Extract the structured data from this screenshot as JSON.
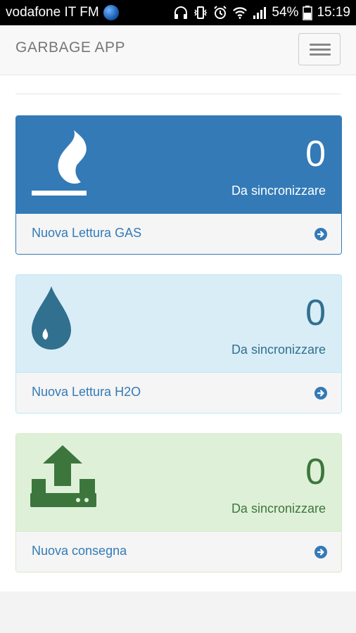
{
  "status_bar": {
    "carrier": "vodafone IT FM",
    "battery": "54%",
    "time": "15:19"
  },
  "navbar": {
    "brand": "GARBAGE APP"
  },
  "panels": [
    {
      "count": "0",
      "label": "Da sincronizzare",
      "footer": "Nuova Lettura GAS",
      "icon": "flame-icon",
      "colors": {
        "heading_bg": "#337ab7",
        "text": "#ffffff",
        "border": "#337ab7"
      }
    },
    {
      "count": "0",
      "label": "Da sincronizzare",
      "footer": "Nuova Lettura H2O",
      "icon": "water-drop-icon",
      "colors": {
        "heading_bg": "#d9edf7",
        "text": "#31708f",
        "border": "#bce8f1"
      }
    },
    {
      "count": "0",
      "label": "Da sincronizzare",
      "footer": "Nuova consegna",
      "icon": "upload-icon",
      "colors": {
        "heading_bg": "#dff0d8",
        "text": "#3c763d",
        "border": "#d6e9c6"
      }
    }
  ]
}
